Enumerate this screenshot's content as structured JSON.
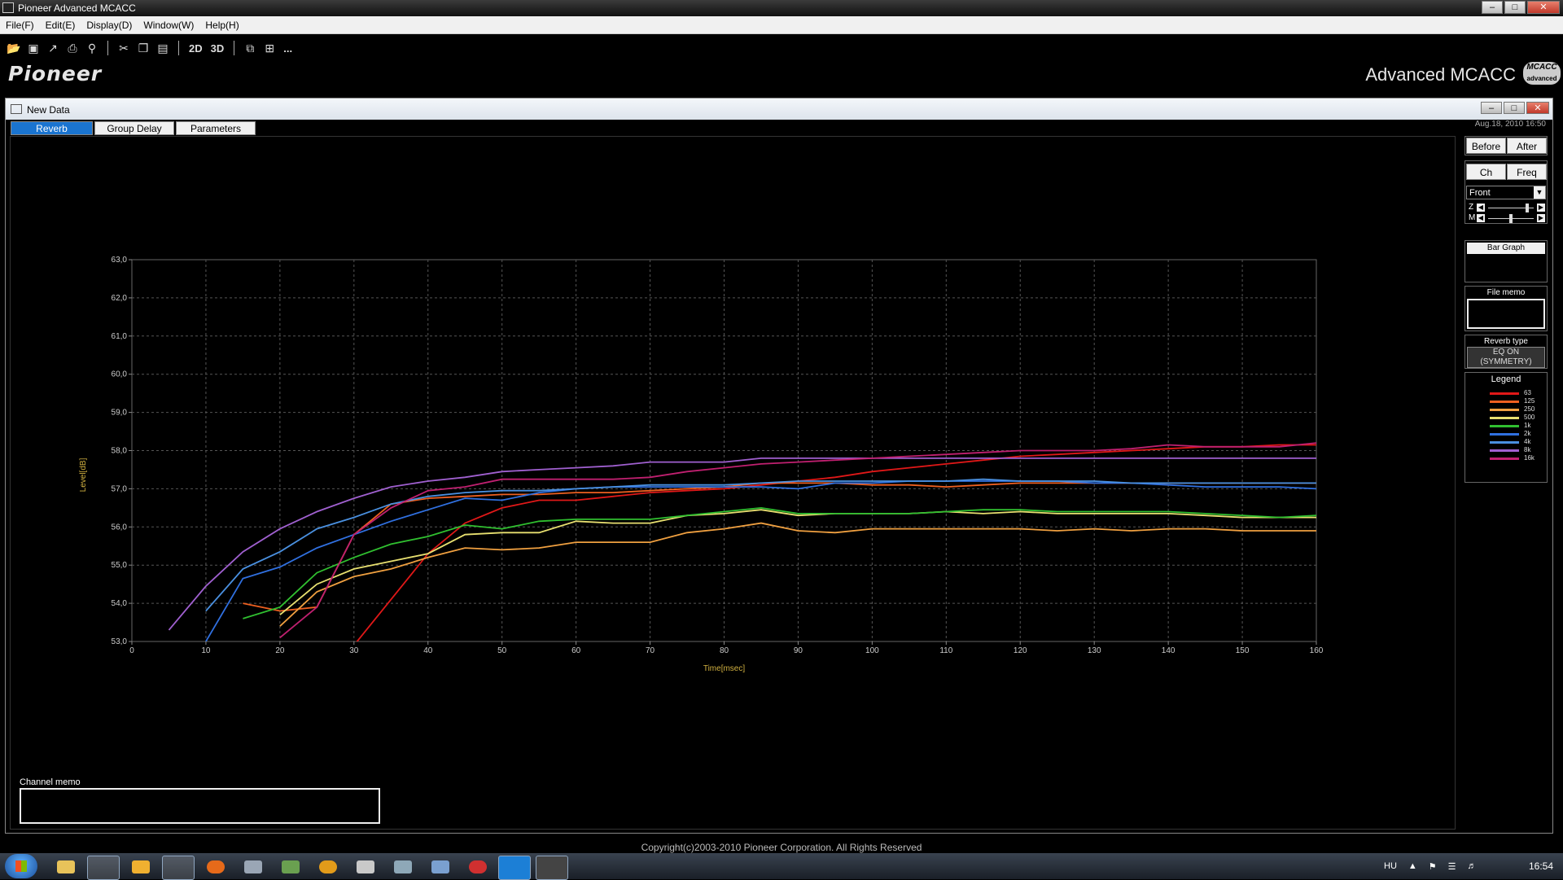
{
  "window": {
    "title": "Pioneer Advanced MCACC"
  },
  "menu": [
    "File(F)",
    "Edit(E)",
    "Display(D)",
    "Window(W)",
    "Help(H)"
  ],
  "toolbar": {
    "icons": [
      "open-icon",
      "save-icon",
      "graph-icon",
      "print-icon",
      "print-preview-icon",
      "cut-icon",
      "copy-icon",
      "paste-icon"
    ],
    "view2d": "2D",
    "view3d": "3D",
    "extra": "...",
    "brand": "Pioneer",
    "product": "Advanced MCACC",
    "badge_line1": "MCACC",
    "badge_line2": "advanced"
  },
  "subwindow": {
    "title": "New Data",
    "datetime": "Aug.18, 2010 16:50",
    "tabs": [
      "Reverb",
      "Group Delay",
      "Parameters"
    ],
    "active_tab": 0
  },
  "panel": {
    "before": "Before",
    "after": "After",
    "ch": "Ch",
    "freq": "Freq",
    "channel": "Front",
    "slider_z": "Z",
    "slider_m": "M",
    "slider_z_level": 0.88,
    "slider_m_level": 0.5,
    "bar_graph": "Bar Graph",
    "file_memo": "File memo",
    "reverb_type": "Reverb type",
    "reverb_type_value1": "EQ ON",
    "reverb_type_value2": "(SYMMETRY)",
    "legend_title": "Legend"
  },
  "channel_memo": "Channel memo",
  "copyright": "Copyright(c)2003-2010 Pioneer Corporation. All Rights Reserved",
  "taskbar": {
    "lang": "HU",
    "time": "16:54"
  },
  "colors": {
    "63": "#e01818",
    "125": "#ee6020",
    "250": "#f0a040",
    "500": "#e8e070",
    "1k": "#30c030",
    "2k": "#3070e0",
    "4k": "#4a90e0",
    "8k": "#a060d0",
    "16k": "#c02070"
  },
  "chart_data": {
    "type": "line",
    "xlabel": "Time[msec]",
    "ylabel": "Level[dB]",
    "xlim": [
      0,
      160
    ],
    "ylim": [
      53.0,
      63.0
    ],
    "xticks": [
      0,
      10,
      20,
      30,
      40,
      50,
      60,
      70,
      80,
      90,
      100,
      110,
      120,
      130,
      140,
      150,
      160
    ],
    "yticks": [
      "53,0",
      "54,0",
      "55,0",
      "56,0",
      "57,0",
      "58,0",
      "59,0",
      "60,0",
      "61,0",
      "62,0",
      "63,0"
    ],
    "grid": true,
    "x": [
      5,
      10,
      15,
      20,
      25,
      30,
      35,
      40,
      45,
      50,
      55,
      60,
      65,
      70,
      75,
      80,
      85,
      90,
      95,
      100,
      105,
      110,
      115,
      120,
      125,
      130,
      135,
      140,
      145,
      150,
      155,
      160
    ],
    "series": [
      {
        "name": "63",
        "color": "#e01818",
        "values": [
          null,
          null,
          null,
          null,
          null,
          52.9,
          54.1,
          55.3,
          56.1,
          56.5,
          56.7,
          56.7,
          56.8,
          56.9,
          56.95,
          57.0,
          57.1,
          57.2,
          57.3,
          57.45,
          57.55,
          57.65,
          57.75,
          57.85,
          57.9,
          57.95,
          58.0,
          58.05,
          58.1,
          58.1,
          58.15,
          58.15
        ]
      },
      {
        "name": "125",
        "color": "#ee6020",
        "values": [
          null,
          null,
          54.0,
          53.8,
          53.9,
          55.8,
          56.6,
          56.75,
          56.8,
          56.85,
          56.85,
          56.9,
          56.9,
          56.95,
          57.0,
          57.05,
          57.15,
          57.15,
          57.15,
          57.1,
          57.1,
          57.05,
          57.1,
          57.15,
          57.15,
          57.15,
          57.15,
          57.15,
          57.15,
          57.15,
          57.15,
          57.15
        ]
      },
      {
        "name": "250",
        "color": "#f0a040",
        "values": [
          null,
          null,
          null,
          53.4,
          54.3,
          54.7,
          54.9,
          55.2,
          55.45,
          55.4,
          55.45,
          55.6,
          55.6,
          55.6,
          55.85,
          55.95,
          56.1,
          55.9,
          55.85,
          55.95,
          55.95,
          55.95,
          55.95,
          55.95,
          55.9,
          55.95,
          55.9,
          55.95,
          55.95,
          55.9,
          55.9,
          55.9
        ]
      },
      {
        "name": "500",
        "color": "#e8e070",
        "values": [
          null,
          null,
          null,
          53.7,
          54.5,
          54.9,
          55.1,
          55.3,
          55.8,
          55.85,
          55.85,
          56.15,
          56.1,
          56.1,
          56.3,
          56.35,
          56.45,
          56.3,
          56.35,
          56.35,
          56.35,
          56.4,
          56.35,
          56.4,
          56.35,
          56.35,
          56.35,
          56.35,
          56.3,
          56.25,
          56.25,
          56.25
        ]
      },
      {
        "name": "1k",
        "color": "#30c030",
        "values": [
          null,
          null,
          53.6,
          53.9,
          54.8,
          55.2,
          55.55,
          55.75,
          56.05,
          55.95,
          56.15,
          56.2,
          56.2,
          56.2,
          56.3,
          56.4,
          56.5,
          56.35,
          56.35,
          56.35,
          56.35,
          56.4,
          56.45,
          56.45,
          56.4,
          56.4,
          56.4,
          56.4,
          56.35,
          56.3,
          56.25,
          56.3
        ]
      },
      {
        "name": "2k",
        "color": "#3070e0",
        "values": [
          null,
          53.0,
          54.65,
          54.95,
          55.45,
          55.8,
          56.15,
          56.45,
          56.75,
          56.7,
          56.9,
          57.0,
          57.05,
          57.05,
          57.05,
          57.05,
          57.05,
          57.0,
          57.15,
          57.15,
          57.2,
          57.2,
          57.2,
          57.2,
          57.2,
          57.15,
          57.15,
          57.1,
          57.05,
          57.05,
          57.05,
          57.0
        ]
      },
      {
        "name": "4k",
        "color": "#4a90e0",
        "values": [
          null,
          53.8,
          54.9,
          55.35,
          55.95,
          56.25,
          56.6,
          56.8,
          56.9,
          56.95,
          56.95,
          57.0,
          57.05,
          57.1,
          57.1,
          57.1,
          57.15,
          57.2,
          57.2,
          57.2,
          57.2,
          57.2,
          57.25,
          57.2,
          57.2,
          57.2,
          57.15,
          57.15,
          57.15,
          57.15,
          57.15,
          57.15
        ]
      },
      {
        "name": "8k",
        "color": "#a060d0",
        "values": [
          53.3,
          54.45,
          55.35,
          55.95,
          56.4,
          56.75,
          57.05,
          57.2,
          57.3,
          57.45,
          57.5,
          57.55,
          57.6,
          57.7,
          57.7,
          57.7,
          57.8,
          57.8,
          57.8,
          57.8,
          57.8,
          57.8,
          57.8,
          57.8,
          57.8,
          57.8,
          57.8,
          57.8,
          57.8,
          57.8,
          57.8,
          57.8
        ]
      },
      {
        "name": "16k",
        "color": "#c02070",
        "values": [
          null,
          null,
          null,
          53.1,
          53.9,
          55.8,
          56.5,
          56.95,
          57.05,
          57.25,
          57.25,
          57.25,
          57.25,
          57.3,
          57.45,
          57.55,
          57.65,
          57.7,
          57.75,
          57.8,
          57.85,
          57.9,
          57.95,
          58.0,
          58.0,
          58.0,
          58.05,
          58.15,
          58.1,
          58.1,
          58.1,
          58.2
        ]
      }
    ]
  }
}
